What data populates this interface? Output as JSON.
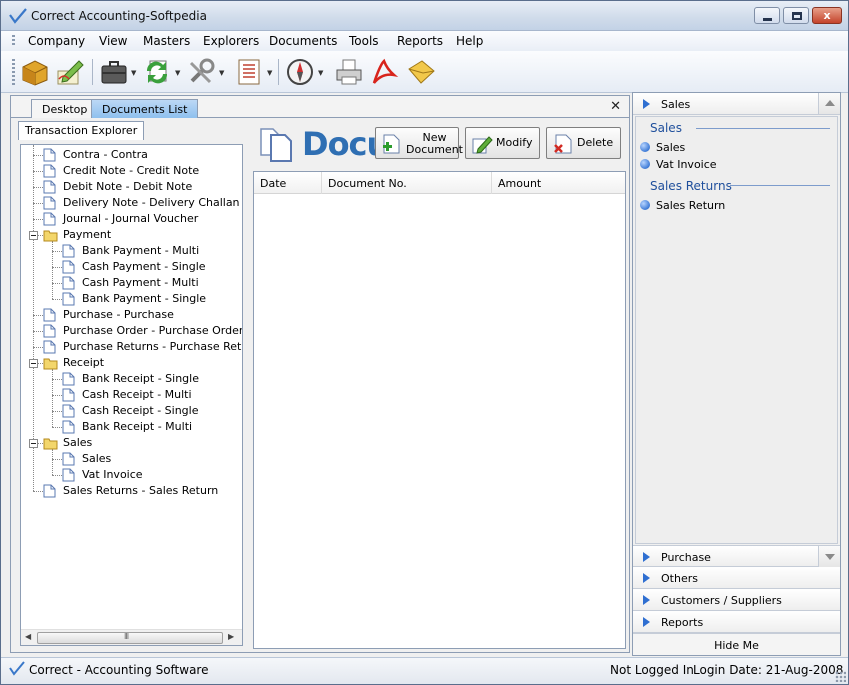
{
  "window": {
    "title": "Correct Accounting-Softpedia",
    "close_glyph": "x"
  },
  "menu": [
    "Company",
    "View",
    "Masters",
    "Explorers",
    "Documents",
    "Tools",
    "Reports",
    "Help"
  ],
  "toolbar": {
    "icons": [
      "package-icon",
      "edit-icon",
      "briefcase-icon",
      "refresh-icon",
      "tools-icon",
      "list-icon",
      "compass-icon",
      "printer-icon",
      "pdf-icon",
      "email-icon"
    ]
  },
  "doc_tabs": {
    "desktop": "Desktop",
    "documents_list": "Documents List",
    "close_glyph": "✕"
  },
  "tree": {
    "tab_label": "Transaction Explorer",
    "items": [
      {
        "label": "Contra - Contra",
        "level": 1,
        "type": "doc"
      },
      {
        "label": "Credit Note - Credit Note",
        "level": 1,
        "type": "doc"
      },
      {
        "label": "Debit Note - Debit Note",
        "level": 1,
        "type": "doc"
      },
      {
        "label": "Delivery Note - Delivery Challan",
        "level": 1,
        "type": "doc"
      },
      {
        "label": "Journal - Journal Voucher",
        "level": 1,
        "type": "doc"
      },
      {
        "label": "Payment",
        "level": 1,
        "type": "folder"
      },
      {
        "label": "Bank Payment - Multi",
        "level": 2,
        "type": "doc"
      },
      {
        "label": "Cash Payment - Single",
        "level": 2,
        "type": "doc"
      },
      {
        "label": "Cash Payment - Multi",
        "level": 2,
        "type": "doc"
      },
      {
        "label": "Bank Payment - Single",
        "level": 2,
        "type": "doc"
      },
      {
        "label": "Purchase - Purchase",
        "level": 1,
        "type": "doc"
      },
      {
        "label": "Purchase Order - Purchase Order",
        "level": 1,
        "type": "doc"
      },
      {
        "label": "Purchase Returns - Purchase Return",
        "level": 1,
        "type": "doc"
      },
      {
        "label": "Receipt",
        "level": 1,
        "type": "folder"
      },
      {
        "label": "Bank Receipt - Single",
        "level": 2,
        "type": "doc"
      },
      {
        "label": "Cash Receipt - Multi",
        "level": 2,
        "type": "doc"
      },
      {
        "label": "Cash Receipt - Single",
        "level": 2,
        "type": "doc"
      },
      {
        "label": "Bank Receipt - Multi",
        "level": 2,
        "type": "doc"
      },
      {
        "label": "Sales",
        "level": 1,
        "type": "folder"
      },
      {
        "label": "Sales",
        "level": 2,
        "type": "doc"
      },
      {
        "label": "Vat Invoice",
        "level": 2,
        "type": "doc"
      },
      {
        "label": "Sales Returns - Sales Return",
        "level": 1,
        "type": "doc"
      }
    ],
    "scroll_grip": "III"
  },
  "documents": {
    "header_title": "Documents",
    "buttons": {
      "new_line1": "New",
      "new_line2": "Document",
      "modify": "Modify",
      "delete": "Delete"
    },
    "columns": [
      "Date",
      "Document No.",
      "Amount"
    ]
  },
  "sidebar": {
    "active_header": "Sales",
    "groups": [
      {
        "title": "Sales",
        "links": [
          "Sales",
          "Vat Invoice"
        ]
      },
      {
        "title": "Sales Returns",
        "links": [
          "Sales Return"
        ]
      }
    ],
    "collapsed": [
      "Purchase",
      "Others",
      "Customers / Suppliers",
      "Reports"
    ],
    "hide_label": "Hide Me"
  },
  "status": {
    "app": "Correct - Accounting Software",
    "login_state": "Not Logged In",
    "login_date": "Login Date: 21-Aug-2008"
  },
  "colors": {
    "accent": "#2f6fb3",
    "tab_active": "#8ec0ee",
    "link_bullet": "#3d7ad6"
  }
}
